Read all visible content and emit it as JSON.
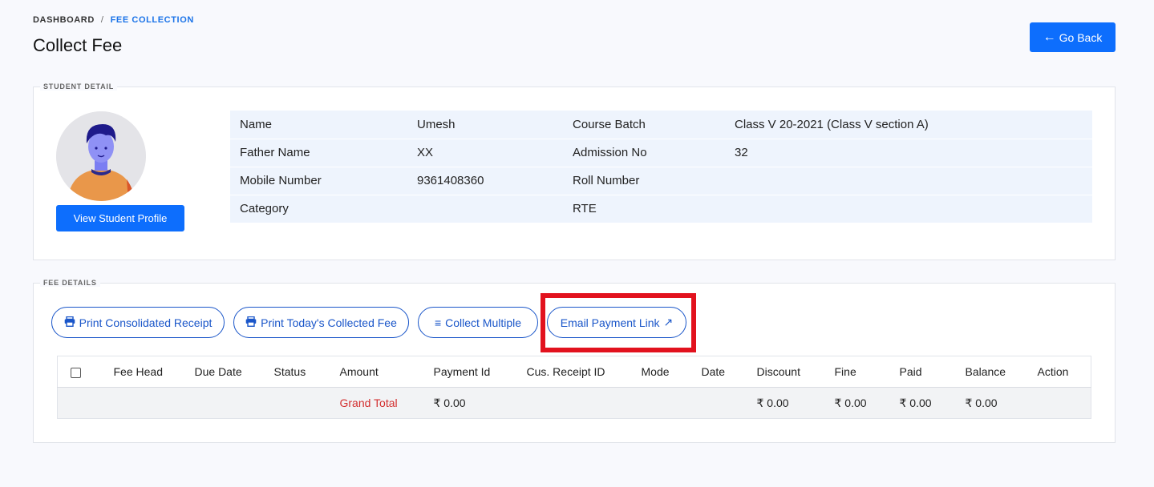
{
  "breadcrumb": {
    "home": "DASHBOARD",
    "separator": "/",
    "current": "FEE COLLECTION"
  },
  "page_title": "Collect Fee",
  "go_back": {
    "icon": "arrow-left-icon",
    "label": "Go Back"
  },
  "student_panel": {
    "legend": "STUDENT DETAIL",
    "view_profile_label": "View Student Profile",
    "rows": [
      {
        "label1": "Name",
        "value1": "Umesh",
        "label2": "Course Batch",
        "value2": "Class V 20-2021 (Class V section A)"
      },
      {
        "label1": "Father Name",
        "value1": "XX",
        "label2": "Admission No",
        "value2": "32"
      },
      {
        "label1": "Mobile Number",
        "value1": "9361408360",
        "label2": "Roll Number",
        "value2": ""
      },
      {
        "label1": "Category",
        "value1": "",
        "label2": "RTE",
        "value2": ""
      }
    ]
  },
  "fee_panel": {
    "legend": "FEE DETAILS",
    "buttons": {
      "print_consolidated": "Print Consolidated Receipt",
      "print_today": "Print Today's Collected Fee",
      "collect_multiple": "Collect Multiple",
      "email_link": "Email Payment Link"
    },
    "columns": [
      "Fee Head",
      "Due Date",
      "Status",
      "Amount",
      "Payment Id",
      "Cus. Receipt ID",
      "Mode",
      "Date",
      "Discount",
      "Fine",
      "Paid",
      "Balance",
      "Action"
    ],
    "grand_total": {
      "label": "Grand Total",
      "payment_id": "₹ 0.00",
      "discount": "₹ 0.00",
      "fine": "₹ 0.00",
      "paid": "₹ 0.00",
      "balance": "₹ 0.00"
    }
  },
  "colors": {
    "primary": "#0d6efd",
    "outline": "#1a56c9",
    "highlight": "#e2121e",
    "grand_total": "#d32f2f"
  }
}
